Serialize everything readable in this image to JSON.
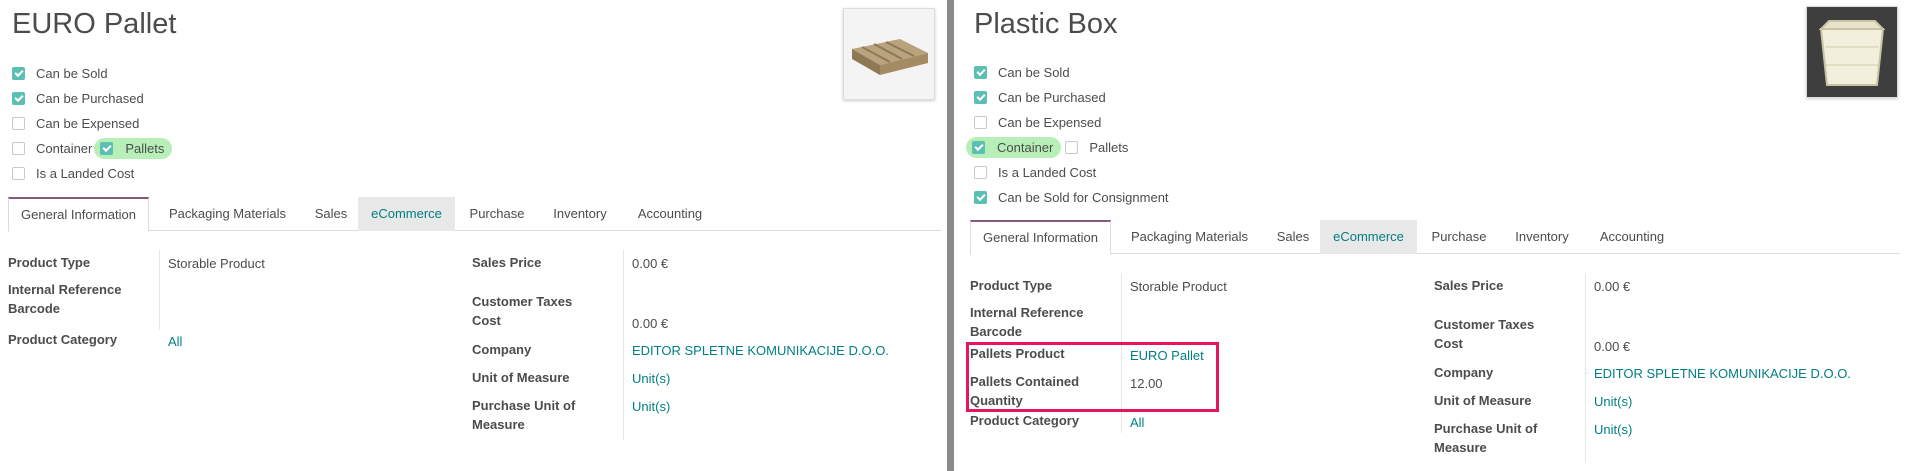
{
  "left": {
    "title": "EURO Pallet",
    "image_icon": "wooden-pallet-image",
    "checks": [
      {
        "label": "Can be Sold",
        "checked": true
      },
      {
        "label": "Can be Purchased",
        "checked": true
      },
      {
        "label": "Can be Expensed",
        "checked": false
      },
      {
        "label": "Container",
        "checked": false
      },
      {
        "label": "Pallets",
        "checked": true
      },
      {
        "label": "Is a Landed Cost",
        "checked": false
      }
    ],
    "tabs": [
      "General Information",
      "Packaging Materials",
      "Sales",
      "eCommerce",
      "Purchase",
      "Inventory",
      "Accounting"
    ],
    "fields": {
      "product_type_label": "Product Type",
      "product_type": "Storable Product",
      "internal_ref_label": "Internal Reference",
      "barcode_label": "Barcode",
      "product_category_label": "Product Category",
      "product_category": "All",
      "sales_price_label": "Sales Price",
      "sales_price": "0.00 €",
      "customer_taxes_label_1": "Customer Taxes",
      "customer_taxes_label_2": "Cost",
      "cost": "0.00 €",
      "company_label": "Company",
      "company": "EDITOR SPLETNE KOMUNIKACIJE D.O.O.",
      "uom_label": "Unit of Measure",
      "uom": "Unit(s)",
      "purchase_uom_label_1": "Purchase Unit of",
      "purchase_uom_label_2": "Measure",
      "purchase_uom": "Unit(s)"
    }
  },
  "right": {
    "title": "Plastic Box",
    "image_icon": "plastic-box-image",
    "checks": [
      {
        "label": "Can be Sold",
        "checked": true
      },
      {
        "label": "Can be Purchased",
        "checked": true
      },
      {
        "label": "Can be Expensed",
        "checked": false
      },
      {
        "label": "Container",
        "checked": true
      },
      {
        "label": "Pallets",
        "checked": false
      },
      {
        "label": "Is a Landed Cost",
        "checked": false
      },
      {
        "label": "Can be Sold for Consignment",
        "checked": true
      }
    ],
    "tabs": [
      "General Information",
      "Packaging Materials",
      "Sales",
      "eCommerce",
      "Purchase",
      "Inventory",
      "Accounting"
    ],
    "fields": {
      "product_type_label": "Product Type",
      "product_type": "Storable Product",
      "internal_ref_label": "Internal Reference",
      "barcode_label": "Barcode",
      "pallets_product_label": "Pallets Product",
      "pallets_product": "EURO Pallet",
      "pallets_qty_label_1": "Pallets Contained",
      "pallets_qty_label_2": "Quantity",
      "pallets_qty": "12.00",
      "product_category_label": "Product Category",
      "product_category": "All",
      "sales_price_label": "Sales Price",
      "sales_price": "0.00 €",
      "customer_taxes_label_1": "Customer Taxes",
      "customer_taxes_label_2": "Cost",
      "cost": "0.00 €",
      "company_label": "Company",
      "company": "EDITOR SPLETNE KOMUNIKACIJE D.O.O.",
      "uom_label": "Unit of Measure",
      "uom": "Unit(s)",
      "purchase_uom_label_1": "Purchase Unit of",
      "purchase_uom_label_2": "Measure",
      "purchase_uom": "Unit(s)"
    }
  },
  "colors": {
    "accent": "#017e84",
    "check": "#5cbfb3",
    "highlight": "#b8efb8",
    "annotation": "#e8155a",
    "tab_active": "#875a7b"
  }
}
